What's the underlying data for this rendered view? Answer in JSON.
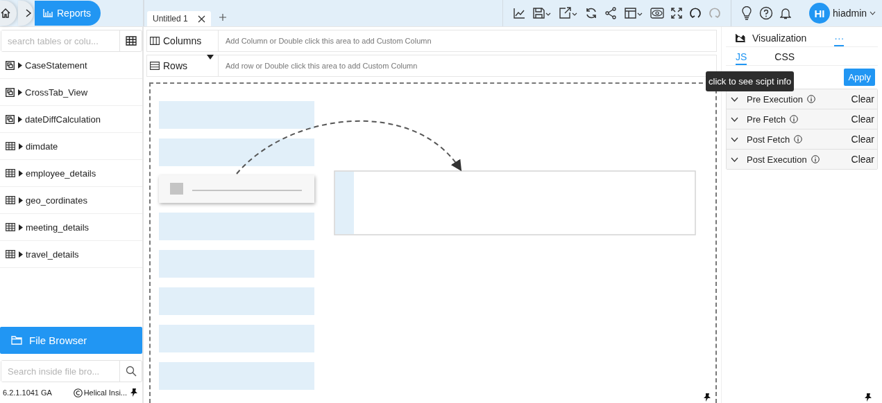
{
  "breadcrumb": {
    "current": "Reports"
  },
  "editor_tabs": [
    {
      "label": "Untitled 1",
      "selected": true
    }
  ],
  "toolbar": {
    "user_initials": "HI",
    "user_name": "hiadmin"
  },
  "sidebar": {
    "search": {
      "placeholder": "search tables or colu..."
    },
    "items": [
      {
        "label": "CaseStatement",
        "kind": "view",
        "expanded": false
      },
      {
        "label": "CrossTab_View",
        "kind": "view",
        "expanded": false
      },
      {
        "label": "dateDiffCalculation",
        "kind": "view",
        "expanded": false
      },
      {
        "label": "dimdate",
        "kind": "table",
        "expanded": false
      },
      {
        "label": "employee_details",
        "kind": "table",
        "expanded": false
      },
      {
        "label": "geo_cordinates",
        "kind": "table",
        "expanded": false
      },
      {
        "label": "meeting_details",
        "kind": "table",
        "expanded": false
      },
      {
        "label": "travel_details",
        "kind": "table",
        "expanded": false
      }
    ],
    "file_browser": "File Browser",
    "file_search": {
      "placeholder": "Search inside file bro..."
    },
    "version": "6.2.1.1041 GA",
    "copyright": "Helical Insi..."
  },
  "shelves": [
    {
      "kind": "columns",
      "label": "Columns",
      "hint": "Add Column or Double click this area to add Custom Column"
    },
    {
      "kind": "rows",
      "label": "Rows",
      "hint": "Add row or Double click this area to add Custom Column"
    }
  ],
  "panel": {
    "tabs": [
      {
        "label": "Visualization",
        "kind": "visualization",
        "selected": false
      },
      {
        "label": "···",
        "kind": "more",
        "selected": true
      }
    ],
    "subtabs": [
      {
        "label": "JS",
        "selected": true
      },
      {
        "label": "CSS",
        "selected": false
      }
    ],
    "apply": "Apply",
    "scripts": [
      {
        "label": "Pre Execution",
        "action": "Clear",
        "expanded": false
      },
      {
        "label": "Pre Fetch",
        "action": "Clear",
        "expanded": false
      },
      {
        "label": "Post Fetch",
        "action": "Clear",
        "expanded": false
      },
      {
        "label": "Post Execution",
        "action": "Clear",
        "expanded": false
      }
    ],
    "tooltip": "click to see scipt info"
  }
}
